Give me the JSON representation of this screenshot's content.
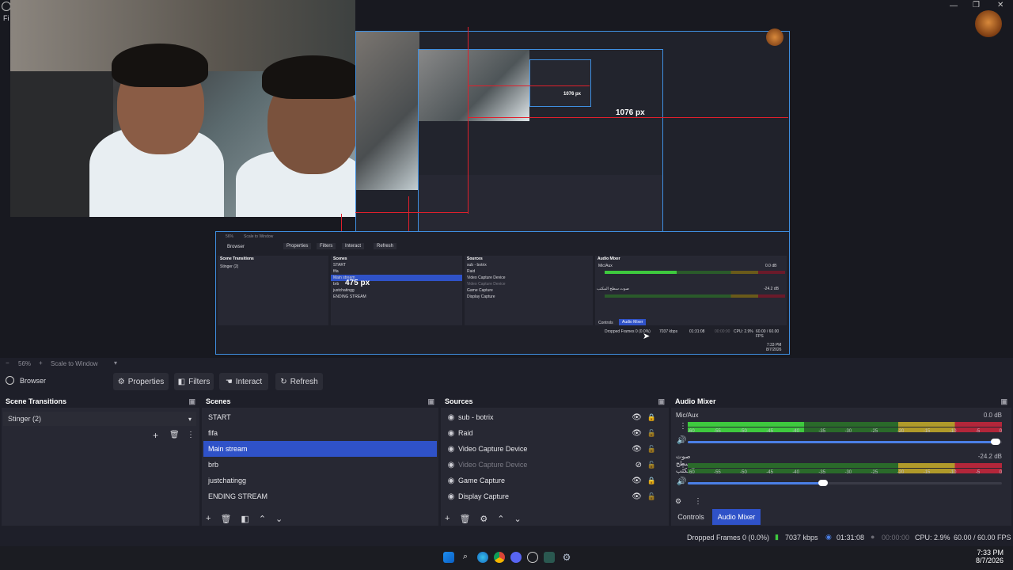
{
  "window": {
    "menu_file": "Fi"
  },
  "preview": {
    "nested_px_horizontal_outer": "1076 px",
    "nested_px_horizontal_inner": "1076 px",
    "nested_px_vertical": "475 px",
    "nested_controls_label": "Controls",
    "nested_audio_mixer_label": "Audio Mixer",
    "nested_scene_list": [
      "START",
      "fifa",
      "Main stream",
      "brb",
      "justchatingg",
      "ENDING STREAM"
    ],
    "nested_source_list": [
      "sub - botrix",
      "Raid",
      "Video Capture Device",
      "Video Capture Device",
      "Game Capture",
      "Display Capture"
    ],
    "nested_dropped_frames": "Dropped Frames 0 (0.0%)",
    "nested_kbps": "7037 kbps",
    "nested_time": "01:31:08",
    "nested_rec_time": "00:00:00",
    "nested_cpu": "CPU: 2.9%",
    "nested_fps": "60.00 / 60.00 FPS",
    "nested_clock": "7:33 PM",
    "nested_date": "8/7/2026",
    "nested_scene_transitions": "Scene Transitions",
    "nested_stinger": "Stinger (2)",
    "nested_scenes": "Scenes",
    "nested_sources": "Sources",
    "nested_mixer": "Audio Mixer",
    "nested_browser": "Browser",
    "nested_properties": "Properties",
    "nested_filters": "Filters",
    "nested_interact": "Interact",
    "nested_refresh": "Refresh",
    "nested_zoom": "56%",
    "nested_scale": "Scale to Window",
    "nested_mic": "Mic/Aux",
    "nested_mic_db": "0.0 dB",
    "nested_desk_db": "-24.2 dB",
    "nested_desk": "صوت سطح المكتب"
  },
  "zoombar": {
    "minus": "−",
    "zoom": "56%",
    "plus": "+",
    "scale_mode": "Scale to Window",
    "dropdown": "▾"
  },
  "toolbar": {
    "source_name": "Browser",
    "properties_label": "Properties",
    "filters_label": "Filters",
    "interact_label": "Interact",
    "refresh_label": "Refresh"
  },
  "scene_transitions": {
    "title": "Scene Transitions",
    "selected": "Stinger (2)"
  },
  "scenes": {
    "title": "Scenes",
    "items": [
      "START",
      "fifa",
      "Main stream",
      "brb",
      "justchatingg",
      "ENDING STREAM"
    ],
    "selected_index": 2
  },
  "sources": {
    "title": "Sources",
    "items": [
      {
        "label": "sub - botrix",
        "icon": "browser-icon",
        "visible": true,
        "locked": true,
        "dim": false
      },
      {
        "label": "Raid",
        "icon": "browser-icon",
        "visible": true,
        "locked": false,
        "dim": false
      },
      {
        "label": "Video Capture Device",
        "icon": "camera-icon",
        "visible": true,
        "locked": false,
        "dim": false
      },
      {
        "label": "Video Capture Device",
        "icon": "camera-icon",
        "visible": false,
        "locked": false,
        "dim": true
      },
      {
        "label": "Game Capture",
        "icon": "gamepad-icon",
        "visible": true,
        "locked": true,
        "dim": false
      },
      {
        "label": "Display Capture",
        "icon": "monitor-icon",
        "visible": true,
        "locked": false,
        "dim": false
      }
    ]
  },
  "audio_mixer": {
    "title": "Audio Mixer",
    "channels": [
      {
        "name": "Mic/Aux",
        "db": "0.0 dB",
        "level_fraction": 0.37,
        "volume_fraction": 0.98
      },
      {
        "name": "صوت سطح المكتب",
        "db": "-24.2 dB",
        "level_fraction": 0.0,
        "volume_fraction": 0.43
      }
    ],
    "scale": [
      "-60",
      "-55",
      "-50",
      "-45",
      "-40",
      "-35",
      "-30",
      "-25",
      "-20",
      "-15",
      "-10",
      "-5",
      "0"
    ],
    "tab_controls": "Controls",
    "tab_audio_mixer": "Audio Mixer"
  },
  "status": {
    "dropped_frames": "Dropped Frames 0 (0.0%)",
    "kbps": "7037 kbps",
    "stream_time": "01:31:08",
    "rec_time": "00:00:00",
    "cpu": "CPU: 2.9%",
    "fps": "60.00 / 60.00 FPS"
  },
  "clock": {
    "time": "7:33 PM",
    "date": "8/7/2026"
  },
  "colors": {
    "accent": "#2f52c8",
    "meter_green": "#3ec93e",
    "meter_yellow": "#b09a2a",
    "meter_red": "#b3263a"
  }
}
